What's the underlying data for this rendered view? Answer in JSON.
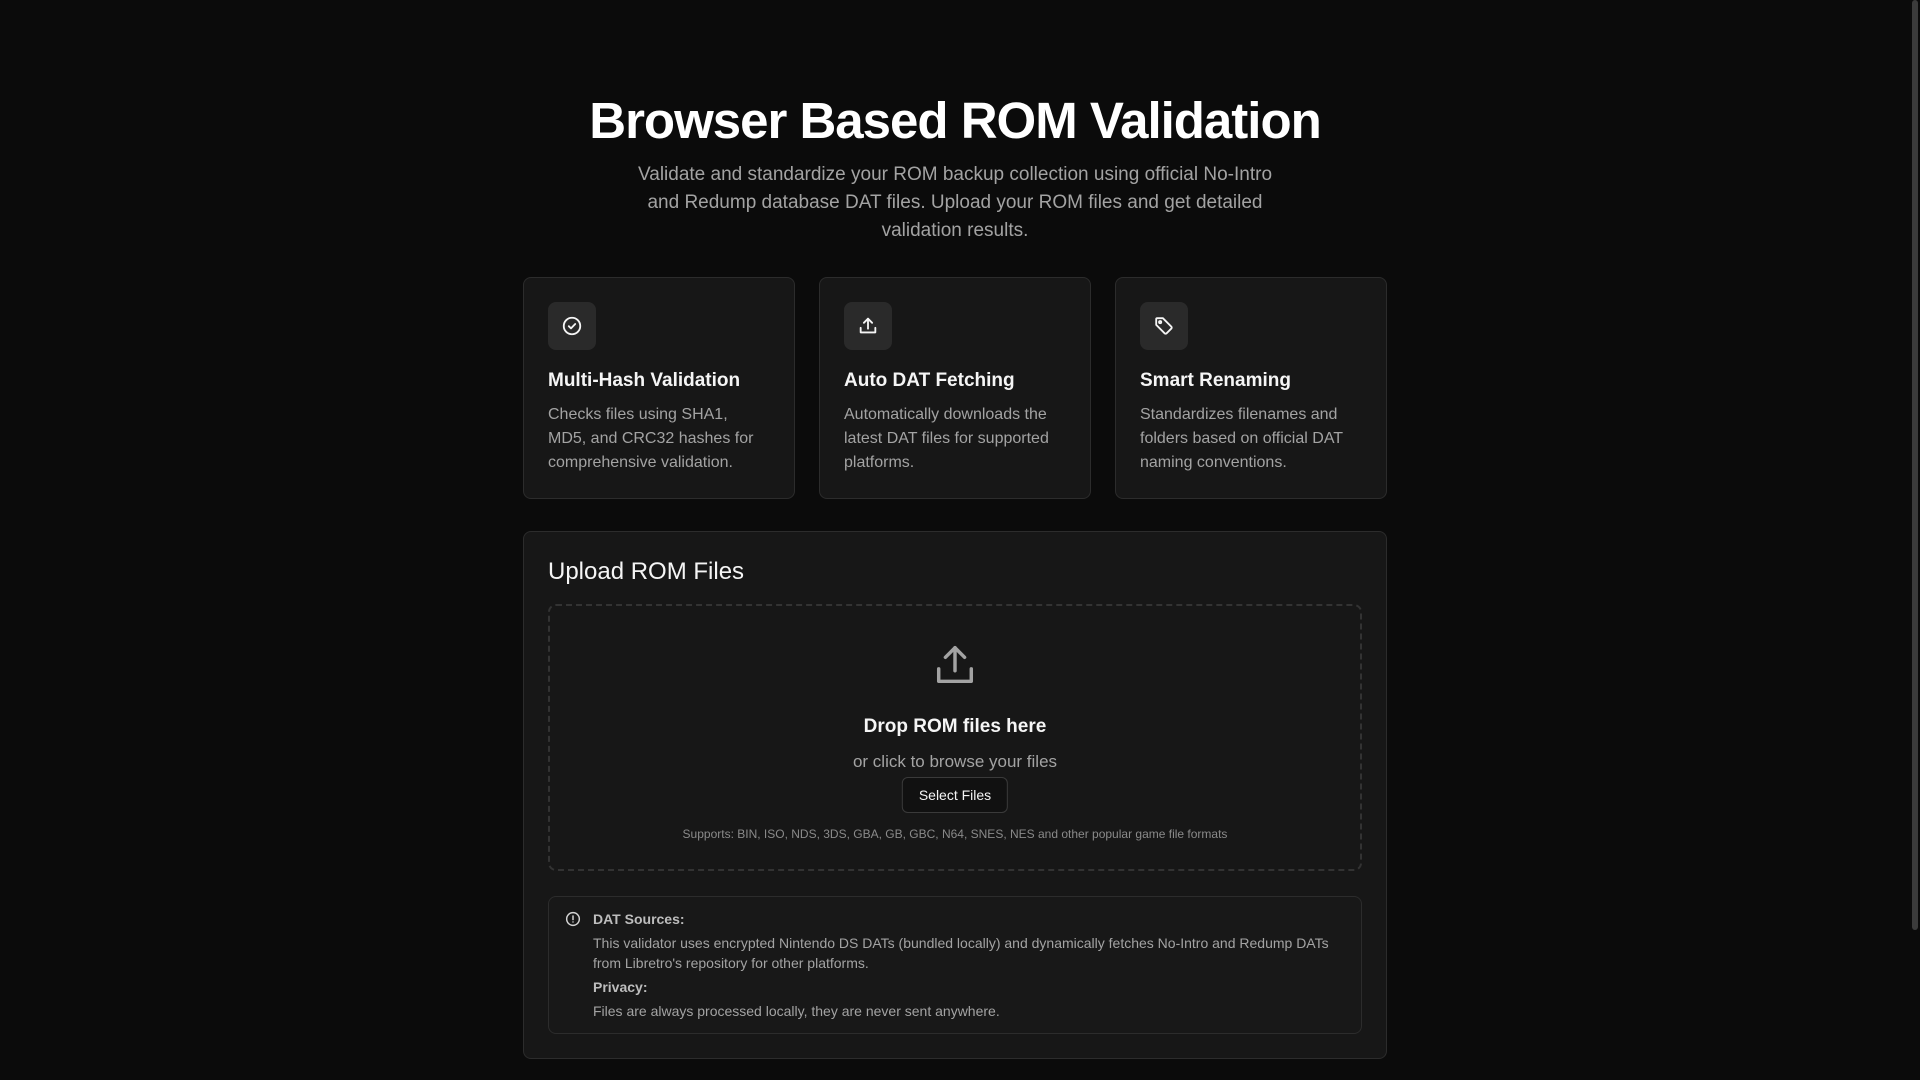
{
  "hero": {
    "title": "Browser Based ROM Validation",
    "subtitle": "Validate and standardize your ROM backup collection using official No-Intro and Redump database DAT files. Upload your ROM files and get detailed validation results."
  },
  "features": [
    {
      "icon": "check-circle-icon",
      "title": "Multi-Hash Validation",
      "description": "Checks files using SHA1, MD5, and CRC32 hashes for comprehensive validation."
    },
    {
      "icon": "upload-icon",
      "title": "Auto DAT Fetching",
      "description": "Automatically downloads the latest DAT files for supported platforms."
    },
    {
      "icon": "tag-icon",
      "title": "Smart Renaming",
      "description": "Standardizes filenames and folders based on official DAT naming conventions."
    }
  ],
  "upload": {
    "title": "Upload ROM Files",
    "drop_title": "Drop ROM files here",
    "drop_subtitle": "or click to browse your files",
    "button_label": "Select Files",
    "supports": "Supports: BIN, ISO, NDS, 3DS, GBA, GB, GBC, N64, SNES, NES and other popular game file formats"
  },
  "info": {
    "icon": "info-circle-icon",
    "dat_label": "DAT Sources:",
    "dat_text": "This validator uses encrypted Nintendo DS DATs (bundled locally) and dynamically fetches No-Intro and Redump DATs from Libretro's repository for other platforms.",
    "privacy_label": "Privacy:",
    "privacy_text": "Files are always processed locally, they are never sent anywhere."
  },
  "colors": {
    "background": "#0b0b0b",
    "card": "#171717",
    "border": "#2c2c2c",
    "muted_text": "#a3a3a3"
  }
}
